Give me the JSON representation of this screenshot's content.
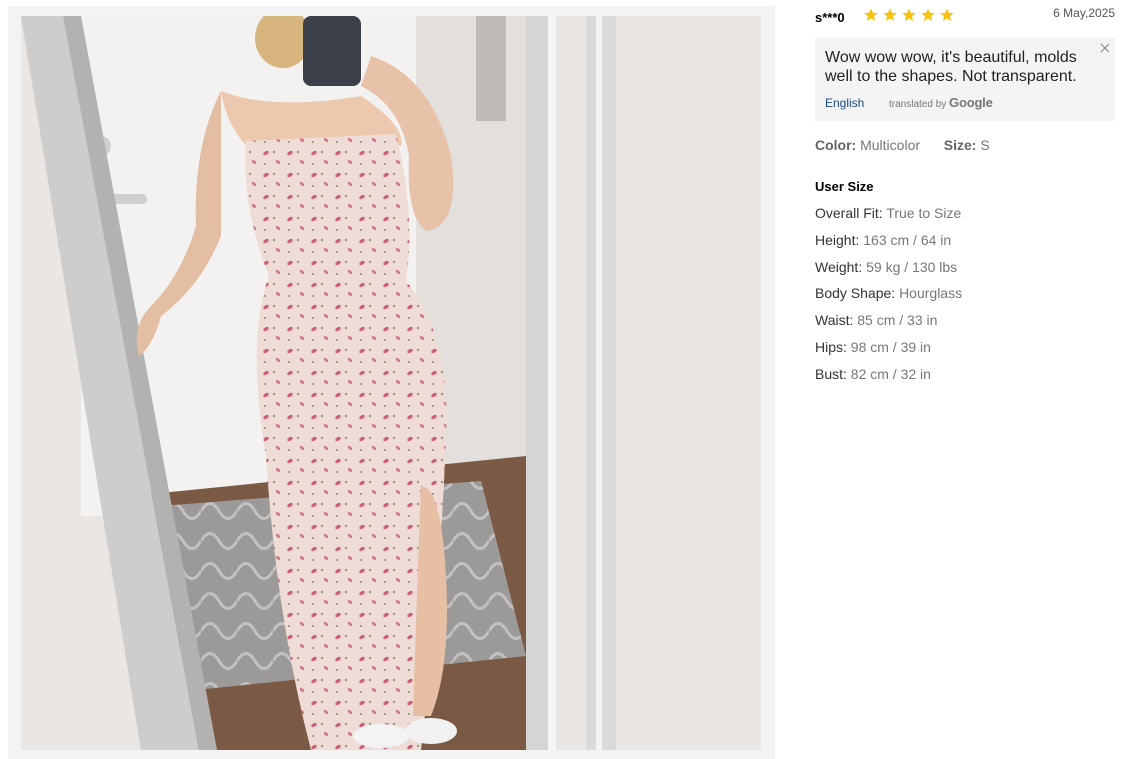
{
  "photo": {
    "alt_subject": "mirror selfie of floral maxi dress",
    "palette": {
      "wall": "#e9e6e4",
      "door": "#f1f0ef",
      "frame": "#c9c7c6",
      "dress": "#efdcd6",
      "floral": "#c8607a",
      "floor": "#7a5a44",
      "rug": "#9c9a98"
    }
  },
  "review": {
    "reviewer": "s***0",
    "rating": 5,
    "star_color": "#f6c315",
    "date": "6 May,2025",
    "text": "Wow wow wow, it's beautiful, molds well to the shapes. Not transparent.",
    "language_link": "English",
    "translated_by": "translated by",
    "translator": "Google",
    "color_label": "Color:",
    "color_value": "Multicolor",
    "size_label": "Size:",
    "size_value": "S",
    "user_size_title": "User Size",
    "user_size": [
      {
        "key": "Overall Fit:",
        "value": "True to Size"
      },
      {
        "key": "Height:",
        "value": "163 cm / 64 in"
      },
      {
        "key": "Weight:",
        "value": "59 kg / 130 lbs"
      },
      {
        "key": "Body Shape:",
        "value": "Hourglass"
      },
      {
        "key": "Waist:",
        "value": "85 cm / 33 in"
      },
      {
        "key": "Hips:",
        "value": "98 cm / 39 in"
      },
      {
        "key": "Bust:",
        "value": "82 cm / 32 in"
      }
    ]
  }
}
